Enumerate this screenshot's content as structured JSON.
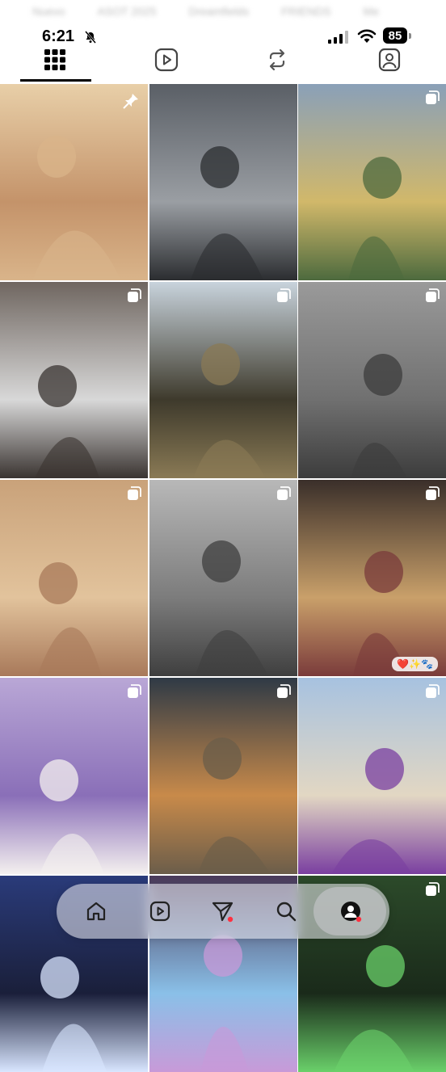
{
  "blurred_header": {
    "items": [
      "Nuevo",
      "ASOT 2025",
      "Dreamfields",
      "FRIENDS",
      "Me"
    ]
  },
  "status_bar": {
    "time": "6:21",
    "battery": "85"
  },
  "tabs": [
    {
      "name": "posts-grid",
      "icon": "grid-icon",
      "active": true
    },
    {
      "name": "reels",
      "icon": "reels-icon",
      "active": false
    },
    {
      "name": "reposts",
      "icon": "repost-icon",
      "active": false
    },
    {
      "name": "tagged",
      "icon": "tagged-person-icon",
      "active": false
    }
  ],
  "grid": {
    "posts": [
      {
        "id": 1,
        "pinned": true,
        "multi": false,
        "palette": [
          "#e8cfa8",
          "#d9b48a",
          "#c4936a"
        ]
      },
      {
        "id": 2,
        "pinned": false,
        "multi": false,
        "palette": [
          "#5a5f66",
          "#2b2d30",
          "#9a9ea3"
        ]
      },
      {
        "id": 3,
        "pinned": false,
        "multi": true,
        "palette": [
          "#8aa0b8",
          "#4d6a3e",
          "#d1b86a"
        ]
      },
      {
        "id": 4,
        "pinned": false,
        "multi": true,
        "palette": [
          "#6f6660",
          "#3a3431",
          "#d8d8d8"
        ]
      },
      {
        "id": 5,
        "pinned": false,
        "multi": true,
        "palette": [
          "#c8d3dc",
          "#8a7a55",
          "#3e3a2c"
        ]
      },
      {
        "id": 6,
        "pinned": false,
        "multi": true,
        "palette": [
          "#9a9a9a",
          "#3c3c3c",
          "#707070"
        ]
      },
      {
        "id": 7,
        "pinned": false,
        "multi": true,
        "palette": [
          "#c9a27a",
          "#a8795a",
          "#e2c39c"
        ]
      },
      {
        "id": 8,
        "pinned": false,
        "multi": true,
        "palette": [
          "#b8b8b8",
          "#3f3f3f",
          "#7c7c7c"
        ]
      },
      {
        "id": 9,
        "pinned": false,
        "multi": true,
        "palette": [
          "#3a2f2a",
          "#7a3b3b",
          "#c9a06a"
        ],
        "badge": "❤️✨🐾"
      },
      {
        "id": 10,
        "pinned": false,
        "multi": true,
        "palette": [
          "#b9a7d6",
          "#f4f0ef",
          "#8a6fb8"
        ]
      },
      {
        "id": 11,
        "pinned": false,
        "multi": true,
        "palette": [
          "#2f3a46",
          "#6b5d4a",
          "#c88a4a"
        ]
      },
      {
        "id": 12,
        "pinned": false,
        "multi": true,
        "palette": [
          "#a7c2e0",
          "#7a3fa0",
          "#e2d7c3"
        ]
      },
      {
        "id": 13,
        "pinned": false,
        "multi": false,
        "palette": [
          "#2a3b7a",
          "#d9e6ff",
          "#1a1f3a"
        ]
      },
      {
        "id": 14,
        "pinned": false,
        "multi": false,
        "palette": [
          "#4a3a5a",
          "#c89ad8",
          "#8ac0e8"
        ]
      },
      {
        "id": 15,
        "pinned": false,
        "multi": true,
        "palette": [
          "#2c4a2a",
          "#6ad06a",
          "#1a2a1a"
        ]
      }
    ]
  },
  "bottom_nav": [
    {
      "name": "home",
      "icon": "home-icon"
    },
    {
      "name": "reels",
      "icon": "reels-icon"
    },
    {
      "name": "messages",
      "icon": "send-icon",
      "notification": true
    },
    {
      "name": "search",
      "icon": "search-icon"
    },
    {
      "name": "profile",
      "icon": "profile-avatar-icon",
      "active": true,
      "notification": true
    }
  ],
  "colors": {
    "accent": "#000000",
    "notification": "#ff3040",
    "background": "#ffffff"
  }
}
